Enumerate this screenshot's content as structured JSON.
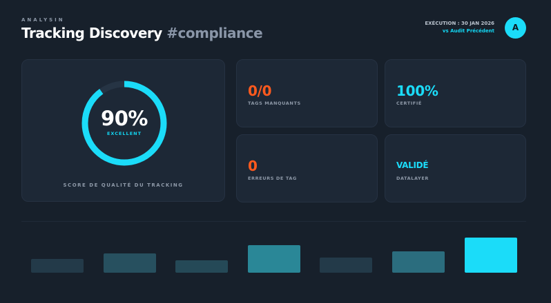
{
  "header": {
    "brand": "ANALYSIN",
    "title_main": "Tracking Discovery",
    "title_tag": "#compliance",
    "execution": "EXÉCUTION : 30 JAN 2026",
    "comparison": "vs Audit Précédent",
    "avatar_initial": "A"
  },
  "score": {
    "value": "90%",
    "rating": "EXCELLENT",
    "caption": "SCORE DE QUALITÉ DU TRACKING",
    "fraction": 0.9
  },
  "stats": [
    {
      "value": "0/0",
      "label": "TAGS MANQUANTS",
      "color": "#ff5a1e"
    },
    {
      "value": "100%",
      "label": "CERTIFIÉ",
      "color": "#1bdcf9"
    },
    {
      "value": "0",
      "label": "ERREURS DE TAG",
      "color": "#ff5a1e"
    },
    {
      "value": "VALIDÉ",
      "label": "DATALAYER",
      "color": "#1bdcf9"
    }
  ],
  "chart_data": {
    "type": "bar",
    "values": [
      20,
      28,
      18,
      40,
      22,
      31,
      51
    ],
    "colors": [
      "#233a49",
      "#27505f",
      "#254957",
      "#2a8797",
      "#233a49",
      "#2b6d7e",
      "#1bdcf9"
    ]
  },
  "colors": {
    "accent": "#1bdcf9",
    "alert": "#ff5a1e",
    "background": "#17202b",
    "card": "#1d2836"
  }
}
